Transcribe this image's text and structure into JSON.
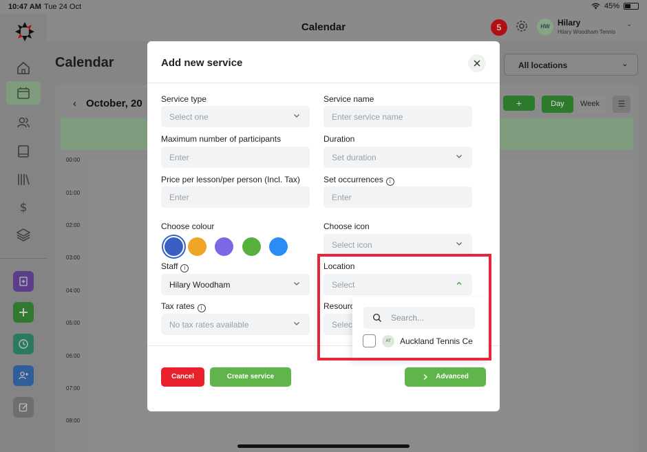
{
  "status_bar": {
    "time": "10:47 AM",
    "date": "Tue 24 Oct",
    "battery": "45%"
  },
  "header": {
    "title": "Calendar",
    "notification_count": "5",
    "user_initials": "HW",
    "user_name": "Hilary",
    "user_subtitle": "Hilary Woodham Tennis"
  },
  "sidebar": {
    "items": [
      {
        "icon": "home-icon"
      },
      {
        "icon": "calendar-icon",
        "active": true
      },
      {
        "icon": "users-icon"
      },
      {
        "icon": "book-icon"
      },
      {
        "icon": "library-icon"
      },
      {
        "icon": "dollar-icon"
      },
      {
        "icon": "layers-icon"
      }
    ],
    "quick_actions": [
      {
        "icon": "add-document-icon",
        "color": "#5b3d8a"
      },
      {
        "icon": "plus-icon",
        "color": "#2f7a2f"
      },
      {
        "icon": "clock-icon",
        "color": "#2a7a5f"
      },
      {
        "icon": "add-user-icon",
        "color": "#2e5f9a"
      },
      {
        "icon": "edit-icon",
        "color": "#6e6e6e"
      }
    ]
  },
  "calendar": {
    "title": "Calendar",
    "location_filter": "All locations",
    "month_label": "October, 20",
    "add_label": "+",
    "view_day": "Day",
    "view_week": "Week",
    "hours": [
      "00:00",
      "01:00",
      "02:00",
      "03:00",
      "04:00",
      "05:00",
      "06:00",
      "07:00",
      "08:00"
    ]
  },
  "modal": {
    "title": "Add new service",
    "service_type": {
      "label": "Service type",
      "placeholder": "Select one"
    },
    "service_name": {
      "label": "Service name",
      "placeholder": "Enter service name"
    },
    "max_participants": {
      "label": "Maximum number of participants",
      "placeholder": "Enter"
    },
    "duration": {
      "label": "Duration",
      "placeholder": "Set duration"
    },
    "price": {
      "label": "Price per lesson/per person (Incl. Tax)",
      "placeholder": "Enter"
    },
    "occurrences": {
      "label": "Set occurrences",
      "placeholder": "Enter"
    },
    "colour": {
      "label": "Choose colour",
      "options": [
        "#3a5fc4",
        "#efa526",
        "#7c68e6",
        "#57b03e",
        "#2a8cf4"
      ],
      "selected_index": 0
    },
    "icon": {
      "label": "Choose icon",
      "placeholder": "Select icon"
    },
    "staff": {
      "label": "Staff",
      "value": "Hilary Woodham"
    },
    "location": {
      "label": "Location",
      "placeholder": "Select",
      "search_placeholder": "Search...",
      "options": [
        {
          "initials": "AT",
          "label": "Auckland Tennis Ce"
        }
      ]
    },
    "tax_rates": {
      "label": "Tax rates",
      "placeholder": "No tax rates available"
    },
    "resources": {
      "label": "Resourc",
      "placeholder": "Select"
    },
    "buttons": {
      "cancel": "Cancel",
      "create": "Create service",
      "advanced": "Advanced"
    }
  },
  "colors": {
    "accent_green": "#5fb44a",
    "danger_red": "#e8212c",
    "highlight_red": "#e8253a"
  }
}
